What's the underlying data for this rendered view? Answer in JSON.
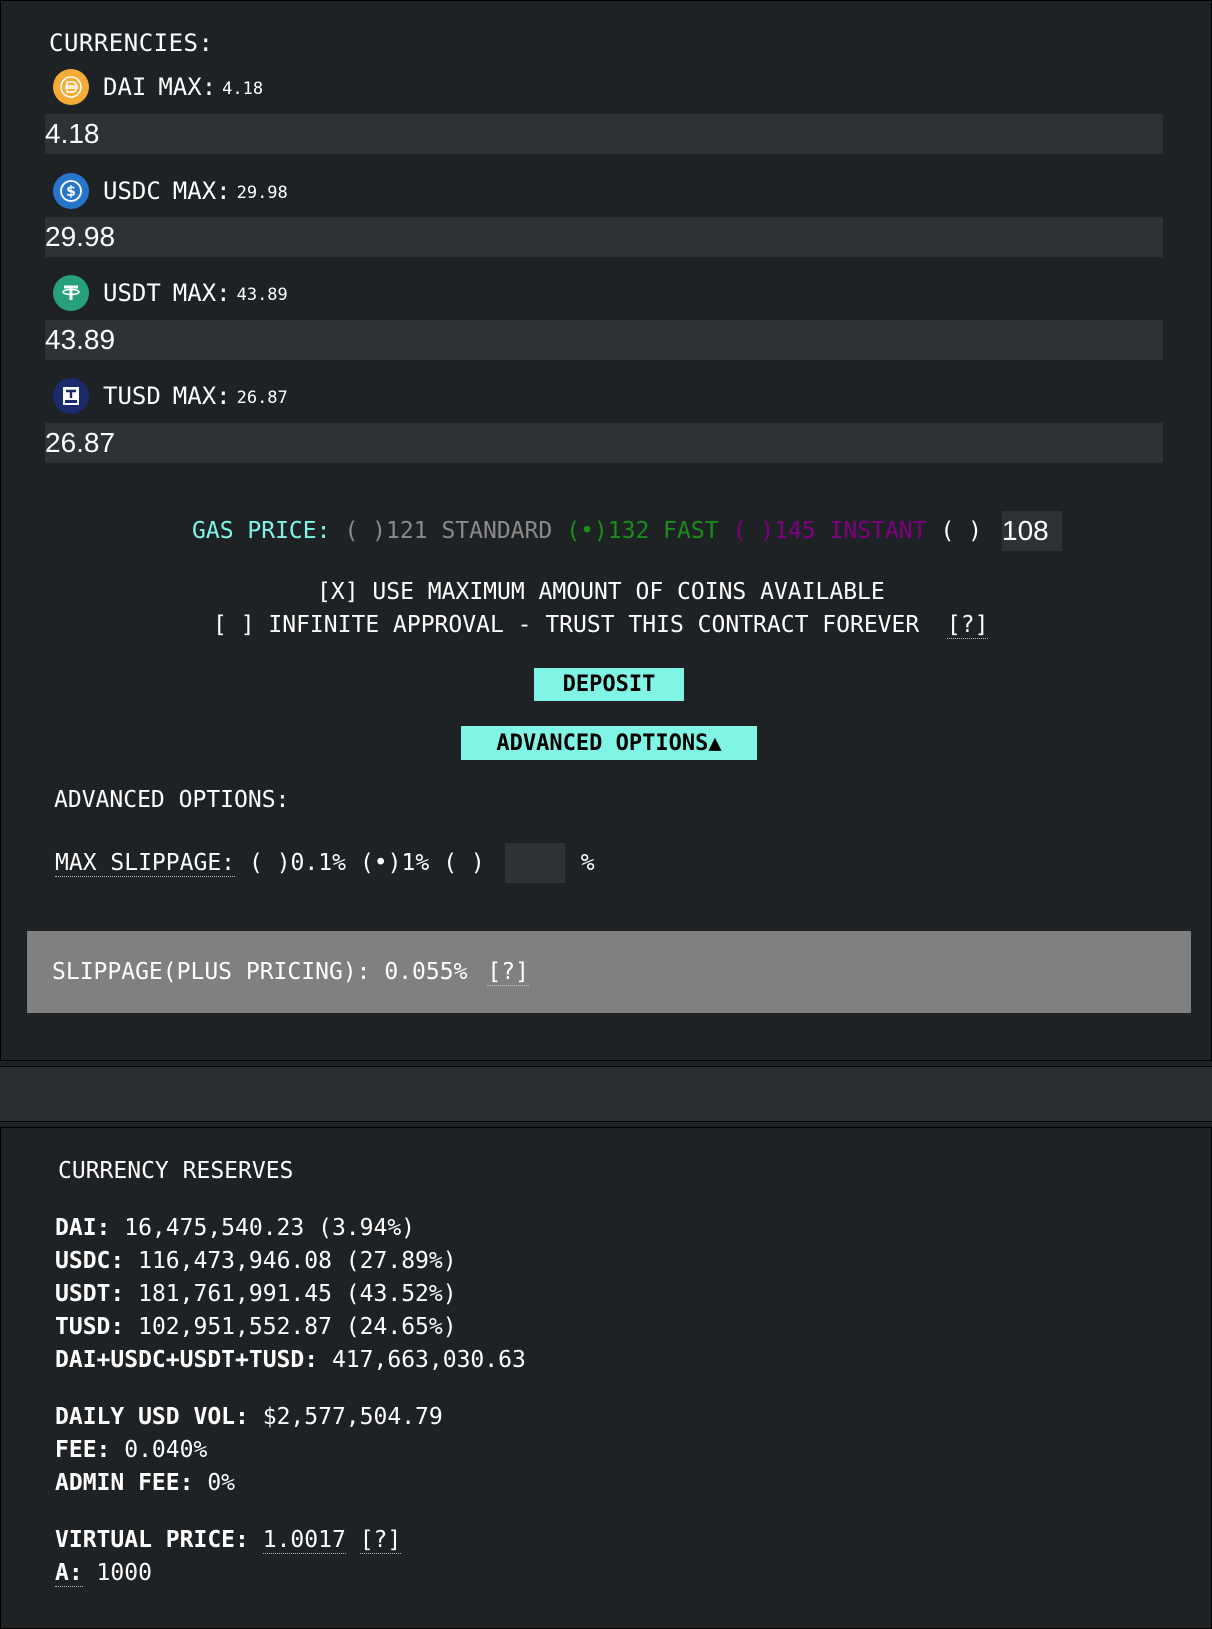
{
  "currencies": {
    "title": "CURRENCIES:",
    "items": [
      {
        "name": "DAI",
        "max_label": "MAX:",
        "max": "4.18",
        "value": "4.18",
        "icon": "dai-icon",
        "color": "#f5ac37"
      },
      {
        "name": "USDC",
        "max_label": "MAX:",
        "max": "29.98",
        "value": "29.98",
        "icon": "usdc-icon",
        "color": "#2775ca"
      },
      {
        "name": "USDT",
        "max_label": "MAX:",
        "max": "43.89",
        "value": "43.89",
        "icon": "usdt-icon",
        "color": "#26a17b"
      },
      {
        "name": "TUSD",
        "max_label": "MAX:",
        "max": "26.87",
        "value": "26.87",
        "icon": "tusd-icon",
        "color": "#1a2b6b"
      }
    ]
  },
  "gas": {
    "label": "GAS PRICE:",
    "options": [
      {
        "mark": "( )",
        "value": "121",
        "name": "STANDARD",
        "color": "#8a8a8a"
      },
      {
        "mark": "(•)",
        "value": "132",
        "name": "FAST",
        "color": "#1a8c1a"
      },
      {
        "mark": "( )",
        "value": "145",
        "name": "INSTANT",
        "color": "#800080"
      }
    ],
    "custom_mark": "( )",
    "custom_value": "108",
    "label_color": "#80f5e6"
  },
  "options": {
    "use_max": "[X] USE MAXIMUM AMOUNT OF COINS AVAILABLE",
    "infinite": "[ ] INFINITE APPROVAL - TRUST THIS CONTRACT FOREVER",
    "help": "[?]"
  },
  "buttons": {
    "deposit": "DEPOSIT",
    "advanced": "ADVANCED OPTIONS▲"
  },
  "advanced": {
    "title": "ADVANCED OPTIONS:",
    "slippage_label": "MAX SLIPPAGE:",
    "opt1": "( )0.1%",
    "opt2": "(•)1%",
    "opt3": "( )",
    "percent": "%"
  },
  "slippage_info": {
    "text": "SLIPPAGE(PLUS PRICING): 0.055%",
    "help": "[?]"
  },
  "reserves": {
    "title": "CURRENCY RESERVES",
    "rows": [
      {
        "label": "DAI:",
        "value": " 16,475,540.23 (3.94%)"
      },
      {
        "label": "USDC:",
        "value": " 116,473,946.08 (27.89%)"
      },
      {
        "label": "USDT:",
        "value": " 181,761,991.45 (43.52%)"
      },
      {
        "label": "TUSD:",
        "value": " 102,951,552.87 (24.65%)"
      },
      {
        "label": "DAI+USDC+USDT+TUSD:",
        "value": " 417,663,030.63"
      }
    ],
    "daily_vol_label": "DAILY USD VOL:",
    "daily_vol": " $2,577,504.79",
    "fee_label": "FEE:",
    "fee": " 0.040%",
    "admin_fee_label": "ADMIN FEE:",
    "admin_fee": " 0%",
    "virtual_price_label": "VIRTUAL PRICE:",
    "virtual_price": "1.0017",
    "virtual_help": "[?]",
    "a_label": "A:",
    "a_value": " 1000"
  }
}
